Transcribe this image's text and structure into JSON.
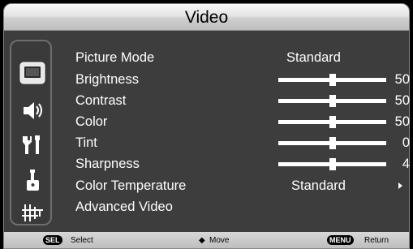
{
  "title": "Video",
  "menu": {
    "items": [
      {
        "label": "Picture Mode",
        "value": "Standard"
      },
      {
        "label": "Brightness",
        "value": "50",
        "level": 50
      },
      {
        "label": "Contrast",
        "value": "50",
        "level": 50
      },
      {
        "label": "Color",
        "value": "50",
        "level": 50
      },
      {
        "label": "Tint",
        "value": "0",
        "level": 50
      },
      {
        "label": "Sharpness",
        "value": "4",
        "level": 50
      },
      {
        "label": "Color Temperature",
        "value": "Standard"
      },
      {
        "label": "Advanced Video"
      }
    ]
  },
  "sidebar_icons": [
    "picture-icon",
    "audio-icon",
    "setup-icon",
    "lock-icon",
    "channel-icon"
  ],
  "footer": {
    "sel_key": "SEL",
    "sel_label": "Select",
    "move_glyph": "◆",
    "move_label": "Move",
    "menu_key": "MENU",
    "return_label": "Return"
  }
}
